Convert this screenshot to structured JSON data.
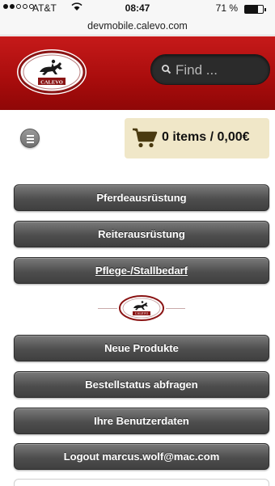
{
  "status_bar": {
    "carrier": "AT&T",
    "time": "08:47",
    "battery": "71 %",
    "battery_level": 0.71,
    "url": "devmobile.calevo.com"
  },
  "header": {
    "logo_text": "CALEVO",
    "search": {
      "placeholder": "Find ..."
    }
  },
  "cart": {
    "label": "0 items / 0,00€"
  },
  "nav_top": [
    {
      "label": "Pferdeausrüstung"
    },
    {
      "label": "Reiterausrüstung"
    },
    {
      "label": "Pflege-/Stallbedarf"
    }
  ],
  "divider_logo_text": "CALEVO",
  "nav_bottom": [
    {
      "label": "Neue Produkte"
    },
    {
      "label": "Bestellstatus abfragen"
    },
    {
      "label": "Ihre Benutzerdaten"
    },
    {
      "label": "Logout marcus.wolf@mac.com"
    }
  ],
  "colors": {
    "header_red": "#a80c0c",
    "cart_bg": "#f0e7c8",
    "button_dark": "#4e4e4e"
  }
}
